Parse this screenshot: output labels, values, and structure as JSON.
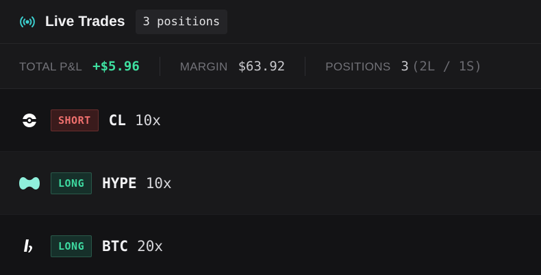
{
  "header": {
    "title": "Live Trades",
    "badge": "3 positions",
    "icon": "broadcast-icon"
  },
  "summary": {
    "pnl_label": "TOTAL P&L",
    "pnl_value": "+$5.96",
    "margin_label": "MARGIN",
    "margin_value": "$63.92",
    "positions_label": "POSITIONS",
    "positions_value": "3",
    "positions_breakdown": "(2L / 1S)"
  },
  "positions": [
    {
      "icon": "cl-oil-icon",
      "side": "SHORT",
      "symbol": "CL",
      "leverage": "10x"
    },
    {
      "icon": "hype-icon",
      "side": "LONG",
      "symbol": "HYPE",
      "leverage": "10x"
    },
    {
      "icon": "btc-icon",
      "side": "LONG",
      "symbol": "BTC",
      "leverage": "20x"
    }
  ],
  "colors": {
    "accent": "#3ed9a0",
    "short": "#f0706e",
    "long": "#3ed9a0",
    "hype": "#8ff0dc",
    "broadcast": "#3ccfcf"
  }
}
